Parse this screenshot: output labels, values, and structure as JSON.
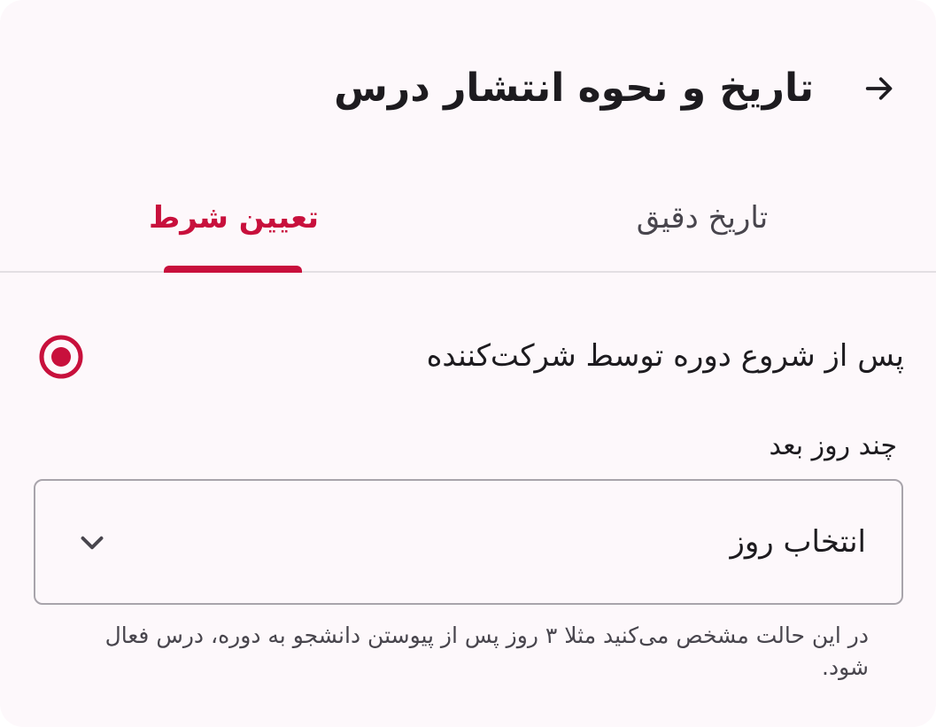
{
  "header": {
    "back_icon": "arrow-right-icon",
    "title": "تاریخ و نحوه انتشار درس"
  },
  "tabs": [
    {
      "label": "تاریخ دقیق",
      "selected": false
    },
    {
      "label": "تعیین شرط",
      "selected": true
    }
  ],
  "option": {
    "label": "پس از شروع دوره توسط شرکت‌کننده",
    "selected": true
  },
  "days_field": {
    "label": "چند روز بعد",
    "value": "انتخاب روز",
    "icon": "chevron-down-icon",
    "helper": "در این حالت مشخص می‌کنید مثلا ۳ روز پس از پیوستن دانشجو به دوره، درس فعال شود."
  },
  "colors": {
    "accent": "#c8103c",
    "background": "#fdf8fb",
    "text": "#1d1b1f",
    "secondary_text": "#48454d",
    "outline": "#a8a4ab"
  }
}
